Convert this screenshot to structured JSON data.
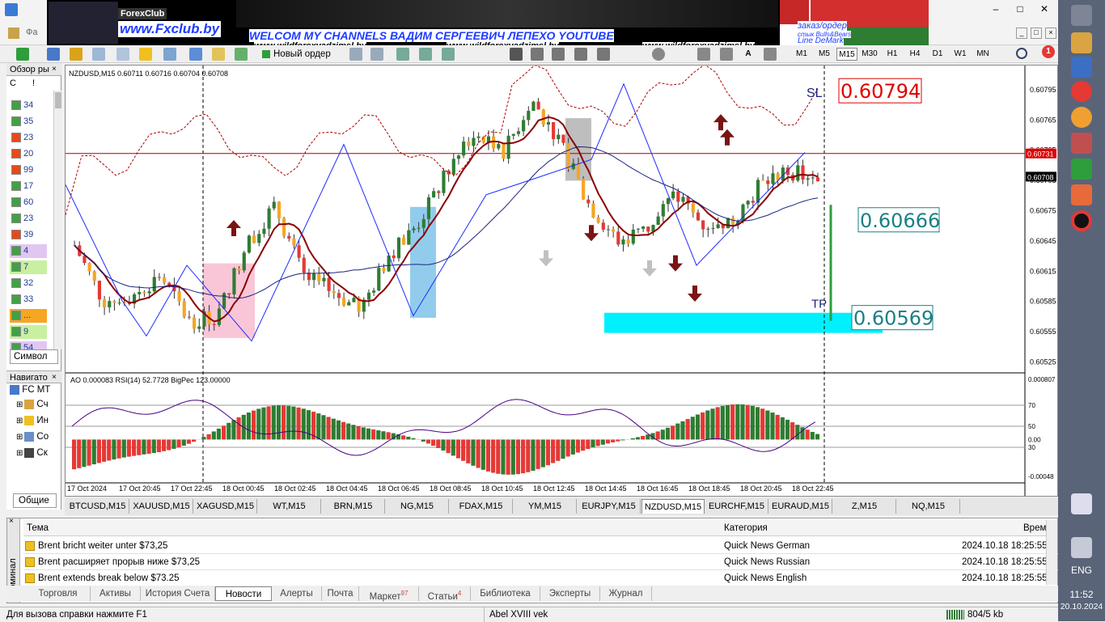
{
  "banner": {
    "logo": "ForexClub",
    "site": "www.Fxclub.by",
    "headline": "WELCOM MY CHANNELS ВАДИМ СЕРГЕЕВИЧ ЛЕПЕХО YOUTUBE",
    "url1": "www.wildforexvadzimsl.by",
    "url2": "www.wildforexvadzimsl.by",
    "url3": "www.wildforexvadzimsl.by",
    "order": "заказ/ордер",
    "bulls": "стык Bulls&Bears",
    "demark": "Line DeMark",
    "menu_partial": "Фа"
  },
  "toolbar": {
    "new_order": "Новый ордер",
    "timeframes": [
      "M1",
      "M5",
      "M15",
      "M30",
      "H1",
      "H4",
      "D1",
      "W1",
      "MN"
    ],
    "active_timeframe": "M15",
    "notification_count": "1"
  },
  "market_watch": {
    "title": "Обзор ры",
    "col1": "С",
    "col2": "!",
    "rows": [
      {
        "v": "34",
        "dir": "up"
      },
      {
        "v": "35",
        "dir": "up"
      },
      {
        "v": "23",
        "dir": "down"
      },
      {
        "v": "20",
        "dir": "down"
      },
      {
        "v": "99",
        "dir": "down"
      },
      {
        "v": "17",
        "dir": "up"
      },
      {
        "v": "60",
        "dir": "up"
      },
      {
        "v": "23",
        "dir": "up"
      },
      {
        "v": "39",
        "dir": "down"
      },
      {
        "v": "4",
        "dir": "up"
      },
      {
        "v": "7",
        "dir": "up"
      },
      {
        "v": "32",
        "dir": "up"
      },
      {
        "v": "33",
        "dir": "up"
      },
      {
        "v": "...",
        "dir": "up"
      },
      {
        "v": "9",
        "dir": "up"
      },
      {
        "v": "54",
        "dir": "up"
      }
    ],
    "tab": "Символ"
  },
  "navigator": {
    "title": "Навигато",
    "root": "FC MT",
    "items": [
      "Сч",
      "Ин",
      "Со",
      "Ск"
    ],
    "tab": "Общие"
  },
  "chart": {
    "header": "NZDUSD,M15  0.60711 0.60716 0.60704 0.60708",
    "sl_label": "SL",
    "sl_value": "0.60794",
    "mid_value": "0.60666",
    "tp_label": "TP",
    "tp_value": "0.60569",
    "price_levels": [
      "0.60795",
      "0.60765",
      "0.60735",
      "0.60705",
      "0.60675",
      "0.60645",
      "0.60615",
      "0.60585",
      "0.60555",
      "0.60525"
    ],
    "current_price": "0.60708",
    "red_line_price": "0.60731",
    "time_labels": [
      "17 Oct 2024",
      "17 Oct 20:45",
      "17 Oct 22:45",
      "18 Oct 00:45",
      "18 Oct 02:45",
      "18 Oct 04:45",
      "18 Oct 06:45",
      "18 Oct 08:45",
      "18 Oct 10:45",
      "18 Oct 12:45",
      "18 Oct 14:45",
      "18 Oct 16:45",
      "18 Oct 18:45",
      "18 Oct 20:45",
      "18 Oct 22:45"
    ],
    "indicator_header": "AO 0.000083  RSI(14) 52.7728  BigPec 123.00000",
    "indicator_levels": [
      "0.000807",
      "70",
      "50",
      "0.00",
      "30",
      "-0.00048"
    ]
  },
  "chart_tabs": [
    "BTCUSD,M15",
    "XAUUSD,M15",
    "XAGUSD,M15",
    "WT,M15",
    "BRN,M15",
    "NG,M15",
    "FDAX,M15",
    "YM,M15",
    "EURJPY,M15",
    "NZDUSD,M15",
    "EURCHF,M15",
    "EURAUD,M15",
    "Z,M15",
    "NQ,M15"
  ],
  "active_chart_tab": "NZDUSD,M15",
  "terminal": {
    "side_label": "Терминал",
    "headers": {
      "topic": "Тема",
      "category": "Категория",
      "time": "Время"
    },
    "rows": [
      {
        "topic": "Brent bricht weiter unter $73,25",
        "category": "Quick News German",
        "time": "2024.10.18 18:25:55"
      },
      {
        "topic": "Brent расширяет прорыв ниже $73,25",
        "category": "Quick News Russian",
        "time": "2024.10.18 18:25:55"
      },
      {
        "topic": "Brent extends break below $73.25",
        "category": "Quick News English",
        "time": "2024.10.18 18:25:55"
      }
    ],
    "tabs": [
      "Торговля",
      "Активы",
      "История Счета",
      "Новости",
      "Алерты",
      "Почта",
      "Маркет",
      "Статьи",
      "Библиотека",
      "Эксперты",
      "Журнал"
    ],
    "market_badge": "97",
    "articles_badge": "4",
    "active_tab": "Новости"
  },
  "status": {
    "help": "Для вызова справки нажмите F1",
    "profile": "Abel XVIII vek",
    "traffic": "804/5 kb"
  },
  "taskbar": {
    "lang": "ENG",
    "time": "11:52",
    "date": "20.10.2024"
  },
  "colors": {
    "bull": "#2e7d32",
    "bear": "#e53935",
    "sl_red": "#e00000",
    "tp_teal": "#1a7f86",
    "cyan_zone": "#00f0ff"
  }
}
